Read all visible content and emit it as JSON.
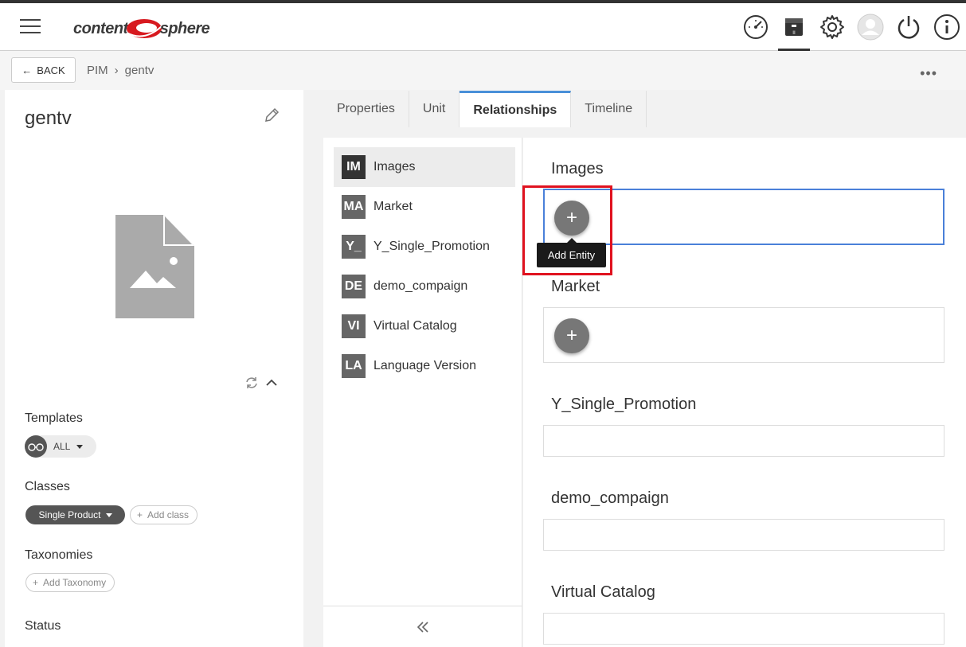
{
  "app": {
    "logo_left": "content",
    "logo_right": "sphere",
    "brand_color": "#d7191f",
    "top_icons": [
      "dashboard-icon",
      "box-icon",
      "gear-icon",
      "user-icon",
      "power-icon",
      "info-icon"
    ]
  },
  "breadcrumb": {
    "back_label": "BACK",
    "items": [
      "PIM",
      "gentv"
    ]
  },
  "entity": {
    "title": "gentv",
    "templates_label": "Templates",
    "templates_value": "ALL",
    "classes_label": "Classes",
    "class_value": "Single Product",
    "add_class_label": "Add class",
    "taxonomies_label": "Taxonomies",
    "add_taxonomy_label": "Add Taxonomy",
    "status_label": "Status"
  },
  "tabs": [
    {
      "label": "Properties"
    },
    {
      "label": "Unit"
    },
    {
      "label": "Relationships"
    },
    {
      "label": "Timeline"
    }
  ],
  "relationships": [
    {
      "badge": "IM",
      "label": "Images"
    },
    {
      "badge": "MA",
      "label": "Market"
    },
    {
      "badge": "Y_",
      "label": "Y_Single_Promotion"
    },
    {
      "badge": "DE",
      "label": "demo_compaign"
    },
    {
      "badge": "VI",
      "label": "Virtual Catalog"
    },
    {
      "badge": "LA",
      "label": "Language Version"
    }
  ],
  "sections": [
    {
      "title": "Images"
    },
    {
      "title": "Market"
    },
    {
      "title": "Y_Single_Promotion"
    },
    {
      "title": "demo_compaign"
    },
    {
      "title": "Virtual Catalog"
    }
  ],
  "tooltip": "Add Entity",
  "colors": {
    "accent": "#4a90d9",
    "highlight": "#e0121f"
  }
}
